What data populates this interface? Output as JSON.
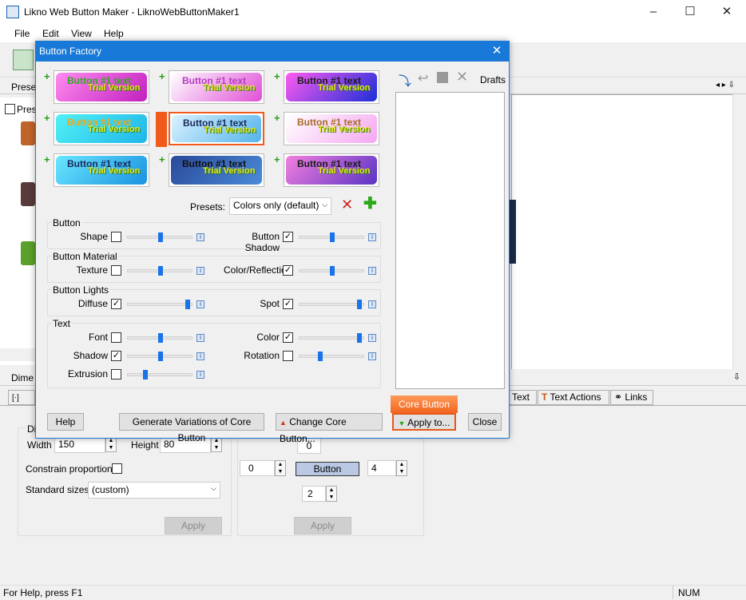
{
  "window": {
    "title": "Likno Web Button Maker - LiknoWebButtonMaker1",
    "min": "–",
    "max": "☐",
    "close": "✕"
  },
  "menu": [
    "File",
    "Edit",
    "View",
    "Help"
  ],
  "panels": {
    "presets_label": "Prese",
    "presets_check": "Prese",
    "dime_label": "Dime",
    "pin": "⇩"
  },
  "tabs": {
    "text": "Text",
    "text_actions": "Text Actions",
    "links": "Links"
  },
  "dimensions": {
    "group_label": "Dim",
    "width_label": "Width",
    "width_value": "150",
    "height_label": "Height",
    "height_value": "80",
    "constrain_label": "Constrain proportions",
    "std_label": "Standard sizes:",
    "std_value": "(custom)",
    "apply": "Apply"
  },
  "margins": {
    "top": "0",
    "left": "0",
    "right": "4",
    "bottom": "2",
    "center": "Button",
    "apply": "Apply"
  },
  "status": {
    "help": "For Help, press F1",
    "num": "NUM"
  },
  "dialog": {
    "title": "Button Factory",
    "close": "✕",
    "thumbs": [
      {
        "text": "Button #1 text",
        "trial": "Trial Version",
        "color1": "#ff8cf0",
        "color2": "#c21fbf",
        "textcolor": "#2faa1f"
      },
      {
        "text": "Button #1 text",
        "trial": "Trial Version",
        "color1": "#ffffff",
        "color2": "#e04fd6",
        "textcolor": "#b53cc0"
      },
      {
        "text": "Button #1 text",
        "trial": "Trial Version",
        "color1": "#ff5bf0",
        "color2": "#1b2fd8",
        "textcolor": "#1c1c1c"
      },
      {
        "text": "Button #1 text",
        "trial": "Trial Version",
        "color1": "#52f0f5",
        "color2": "#1fb6e8",
        "textcolor": "#e9a820"
      },
      {
        "text": "Button #1 text",
        "trial": "Trial Version",
        "color1": "#d9f2ff",
        "color2": "#54b3ea",
        "textcolor": "#1c2b5a"
      },
      {
        "text": "Button #1 text",
        "trial": "Trial Version",
        "color1": "#ffffff",
        "color2": "#f4a7f0",
        "textcolor": "#a86a2a"
      },
      {
        "text": "Button #1 text",
        "trial": "Trial Version",
        "color1": "#6ae6ff",
        "color2": "#1a92e0",
        "textcolor": "#1a2a5a"
      },
      {
        "text": "Button #1 text",
        "trial": "Trial Version",
        "color1": "#2a4a9a",
        "color2": "#4a8ad8",
        "textcolor": "#111"
      },
      {
        "text": "Button #1 text",
        "trial": "Trial Version",
        "color1": "#f27fe0",
        "color2": "#5a34c4",
        "textcolor": "#1c1c1c"
      }
    ],
    "presets_label": "Presets:",
    "presets_value": "Colors only (default)",
    "groups": {
      "button": {
        "label": "Button",
        "shape": "Shape",
        "shadow": "Button Shadow"
      },
      "material": {
        "label": "Button Material",
        "texture": "Texture",
        "color_reflection": "Color/Reflection"
      },
      "lights": {
        "label": "Button Lights",
        "diffuse": "Diffuse",
        "spot": "Spot"
      },
      "text": {
        "label": "Text",
        "font": "Font",
        "color": "Color",
        "shadow": "Shadow",
        "rotation": "Rotation",
        "extrusion": "Extrusion"
      }
    },
    "sliders": {
      "shape": 0.5,
      "shadow": 0.5,
      "texture": 0.5,
      "color_reflection": 0.5,
      "diffuse": 0.95,
      "spot": 0.95,
      "font": 0.5,
      "color": 0.95,
      "tshadow": 0.5,
      "rotation": 0.3,
      "extrusion": 0.25
    },
    "drafts": "Drafts",
    "core_button": "Core Button",
    "buttons": {
      "help": "Help",
      "generate": "Generate Variations of Core Button",
      "change_core": "Change Core Button...",
      "apply_to": "Apply to...",
      "close": "Close"
    },
    "info": "i"
  }
}
